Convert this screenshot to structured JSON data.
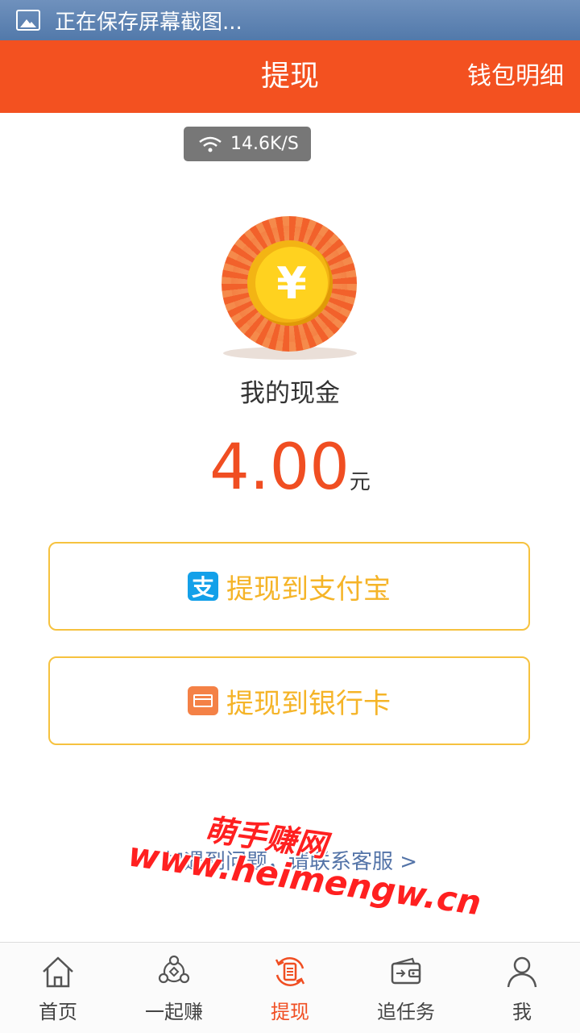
{
  "status_bar": {
    "text": "正在保存屏幕截图..."
  },
  "header": {
    "title": "提现",
    "right_link": "钱包明细"
  },
  "speed_badge": {
    "text": "14.6K/S"
  },
  "coin": {
    "symbol": "¥"
  },
  "cash": {
    "label": "我的现金",
    "amount": "4.00",
    "unit": "元"
  },
  "buttons": {
    "alipay": {
      "label": "提现到支付宝",
      "icon": "alipay-icon",
      "icon_glyph": "支"
    },
    "bank": {
      "label": "提现到银行卡",
      "icon": "bank-card-icon"
    }
  },
  "help": {
    "text": "如遇到问题，请联系客服 >"
  },
  "watermark": {
    "line1": "萌手赚网",
    "line2": "www.heimengw.cn"
  },
  "tabs": [
    {
      "label": "首页",
      "icon": "home-icon",
      "active": false
    },
    {
      "label": "一起赚",
      "icon": "share-icon",
      "active": false
    },
    {
      "label": "提现",
      "icon": "withdraw-icon",
      "active": true
    },
    {
      "label": "追任务",
      "icon": "wallet-icon",
      "active": false
    },
    {
      "label": "我",
      "icon": "profile-icon",
      "active": false
    }
  ],
  "colors": {
    "brand": "#f35120",
    "amount": "#f04e22",
    "button_border": "#f6c23f",
    "button_text": "#f5b428"
  }
}
